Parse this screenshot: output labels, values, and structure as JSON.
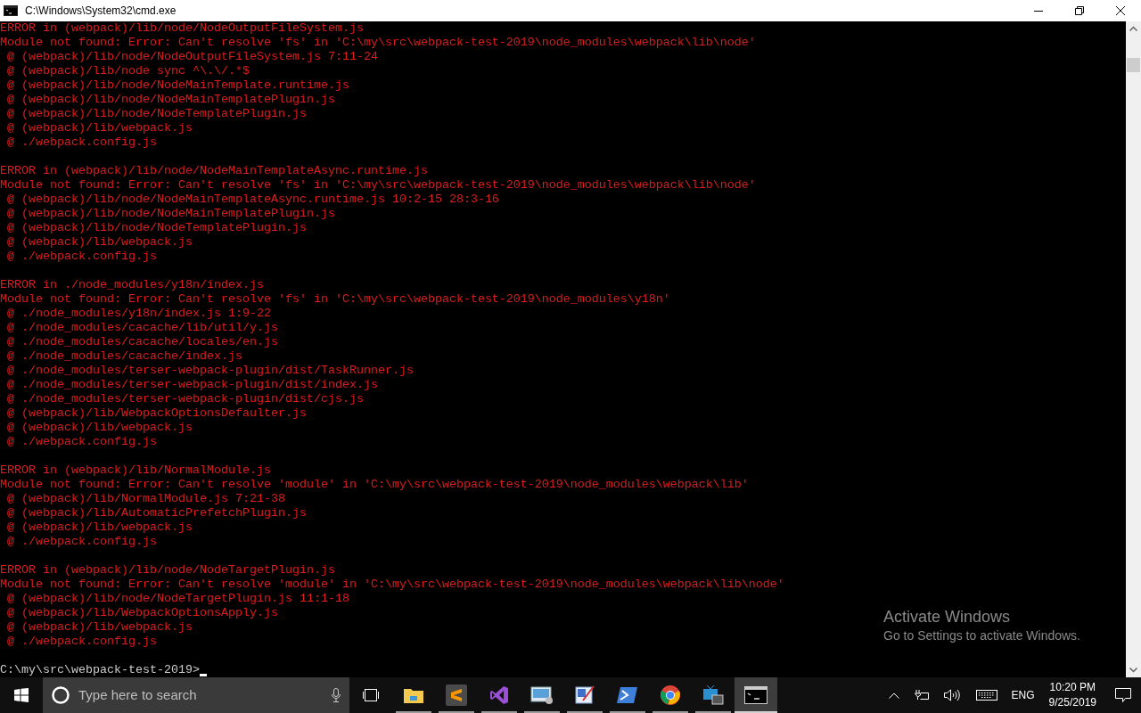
{
  "window": {
    "title": "C:\\Windows\\System32\\cmd.exe"
  },
  "console": {
    "lines": [
      {
        "kind": "error",
        "text": "ERROR in (webpack)/lib/node/NodeOutputFileSystem.js"
      },
      {
        "kind": "error",
        "text": "Module not found: Error: Can't resolve 'fs' in 'C:\\my\\src\\webpack-test-2019\\node_modules\\webpack\\lib\\node'"
      },
      {
        "kind": "error",
        "text": " @ (webpack)/lib/node/NodeOutputFileSystem.js 7:11-24"
      },
      {
        "kind": "error",
        "text": " @ (webpack)/lib/node sync ^\\.\\/.*$"
      },
      {
        "kind": "error",
        "text": " @ (webpack)/lib/node/NodeMainTemplate.runtime.js"
      },
      {
        "kind": "error",
        "text": " @ (webpack)/lib/node/NodeMainTemplatePlugin.js"
      },
      {
        "kind": "error",
        "text": " @ (webpack)/lib/node/NodeTemplatePlugin.js"
      },
      {
        "kind": "error",
        "text": " @ (webpack)/lib/webpack.js"
      },
      {
        "kind": "error",
        "text": " @ ./webpack.config.js"
      },
      {
        "kind": "blank"
      },
      {
        "kind": "error",
        "text": "ERROR in (webpack)/lib/node/NodeMainTemplateAsync.runtime.js"
      },
      {
        "kind": "error",
        "text": "Module not found: Error: Can't resolve 'fs' in 'C:\\my\\src\\webpack-test-2019\\node_modules\\webpack\\lib\\node'"
      },
      {
        "kind": "error",
        "text": " @ (webpack)/lib/node/NodeMainTemplateAsync.runtime.js 10:2-15 28:3-16"
      },
      {
        "kind": "error",
        "text": " @ (webpack)/lib/node/NodeMainTemplatePlugin.js"
      },
      {
        "kind": "error",
        "text": " @ (webpack)/lib/node/NodeTemplatePlugin.js"
      },
      {
        "kind": "error",
        "text": " @ (webpack)/lib/webpack.js"
      },
      {
        "kind": "error",
        "text": " @ ./webpack.config.js"
      },
      {
        "kind": "blank"
      },
      {
        "kind": "error",
        "text": "ERROR in ./node_modules/y18n/index.js"
      },
      {
        "kind": "error",
        "text": "Module not found: Error: Can't resolve 'fs' in 'C:\\my\\src\\webpack-test-2019\\node_modules\\y18n'"
      },
      {
        "kind": "error",
        "text": " @ ./node_modules/y18n/index.js 1:9-22"
      },
      {
        "kind": "error",
        "text": " @ ./node_modules/cacache/lib/util/y.js"
      },
      {
        "kind": "error",
        "text": " @ ./node_modules/cacache/locales/en.js"
      },
      {
        "kind": "error",
        "text": " @ ./node_modules/cacache/index.js"
      },
      {
        "kind": "error",
        "text": " @ ./node_modules/terser-webpack-plugin/dist/TaskRunner.js"
      },
      {
        "kind": "error",
        "text": " @ ./node_modules/terser-webpack-plugin/dist/index.js"
      },
      {
        "kind": "error",
        "text": " @ ./node_modules/terser-webpack-plugin/dist/cjs.js"
      },
      {
        "kind": "error",
        "text": " @ (webpack)/lib/WebpackOptionsDefaulter.js"
      },
      {
        "kind": "error",
        "text": " @ (webpack)/lib/webpack.js"
      },
      {
        "kind": "error",
        "text": " @ ./webpack.config.js"
      },
      {
        "kind": "blank"
      },
      {
        "kind": "error",
        "text": "ERROR in (webpack)/lib/NormalModule.js"
      },
      {
        "kind": "error",
        "text": "Module not found: Error: Can't resolve 'module' in 'C:\\my\\src\\webpack-test-2019\\node_modules\\webpack\\lib'"
      },
      {
        "kind": "error",
        "text": " @ (webpack)/lib/NormalModule.js 7:21-38"
      },
      {
        "kind": "error",
        "text": " @ (webpack)/lib/AutomaticPrefetchPlugin.js"
      },
      {
        "kind": "error",
        "text": " @ (webpack)/lib/webpack.js"
      },
      {
        "kind": "error",
        "text": " @ ./webpack.config.js"
      },
      {
        "kind": "blank"
      },
      {
        "kind": "error",
        "text": "ERROR in (webpack)/lib/node/NodeTargetPlugin.js"
      },
      {
        "kind": "error",
        "text": "Module not found: Error: Can't resolve 'module' in 'C:\\my\\src\\webpack-test-2019\\node_modules\\webpack\\lib\\node'"
      },
      {
        "kind": "error",
        "text": " @ (webpack)/lib/node/NodeTargetPlugin.js 11:1-18"
      },
      {
        "kind": "error",
        "text": " @ (webpack)/lib/WebpackOptionsApply.js"
      },
      {
        "kind": "error",
        "text": " @ (webpack)/lib/webpack.js"
      },
      {
        "kind": "error",
        "text": " @ ./webpack.config.js"
      },
      {
        "kind": "blank"
      },
      {
        "kind": "prompt",
        "text": "C:\\my\\src\\webpack-test-2019>"
      }
    ]
  },
  "activation_notice": {
    "title": "Activate Windows",
    "subtitle": "Go to Settings to activate Windows."
  },
  "taskbar": {
    "search": {
      "placeholder": "Type here to search"
    },
    "apps": [
      {
        "kind": "folder",
        "running": true,
        "active": false
      },
      {
        "kind": "sublime",
        "running": true,
        "active": false
      },
      {
        "kind": "visualstudio",
        "running": true,
        "active": false
      },
      {
        "kind": "photos",
        "running": true,
        "active": false
      },
      {
        "kind": "paint",
        "running": true,
        "active": false
      },
      {
        "kind": "powershell",
        "running": true,
        "active": false
      },
      {
        "kind": "chrome",
        "running": true,
        "active": false
      },
      {
        "kind": "tv",
        "running": true,
        "active": false
      },
      {
        "kind": "cmd",
        "running": true,
        "active": true
      }
    ],
    "language": "ENG",
    "time": "10:20 PM",
    "date": "9/25/2019"
  }
}
